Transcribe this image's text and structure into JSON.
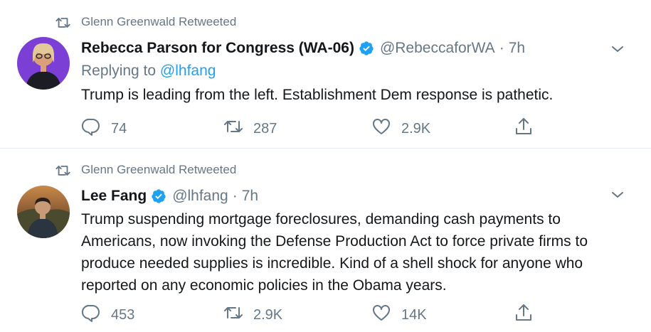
{
  "tweets": [
    {
      "retweeted_by": "Glenn Greenwald Retweeted",
      "name": "Rebecca Parson for Congress (WA-06)",
      "handle": "@RebeccaforWA",
      "separator": "·",
      "time": "7h",
      "replying_prefix": "Replying to",
      "replying_to": "@lhfang",
      "text": "Trump is leading from the left. Establishment Dem response is pathetic.",
      "replies": "74",
      "retweets": "287",
      "likes": "2.9K"
    },
    {
      "retweeted_by": "Glenn Greenwald Retweeted",
      "name": "Lee Fang",
      "handle": "@lhfang",
      "separator": "·",
      "time": "7h",
      "text": "Trump suspending mortgage foreclosures, demanding cash payments to Americans, now invoking the Defense Production Act to force private firms to produce needed supplies is incredible. Kind of a shell shock for anyone who reported on any economic policies in the Obama years.",
      "replies": "453",
      "retweets": "2.9K",
      "likes": "14K"
    }
  ],
  "colors": {
    "secondary_text": "#657786",
    "link": "#1da1f2",
    "verified_badge": "#1da1f2",
    "divider": "#e6ecf0"
  },
  "icons": {
    "retweeted_indicator": "retweet-icon",
    "verified": "verified-badge-icon",
    "more": "chevron-down-icon",
    "reply": "reply-icon",
    "retweet": "retweet-icon",
    "like": "heart-icon",
    "share": "share-icon"
  }
}
